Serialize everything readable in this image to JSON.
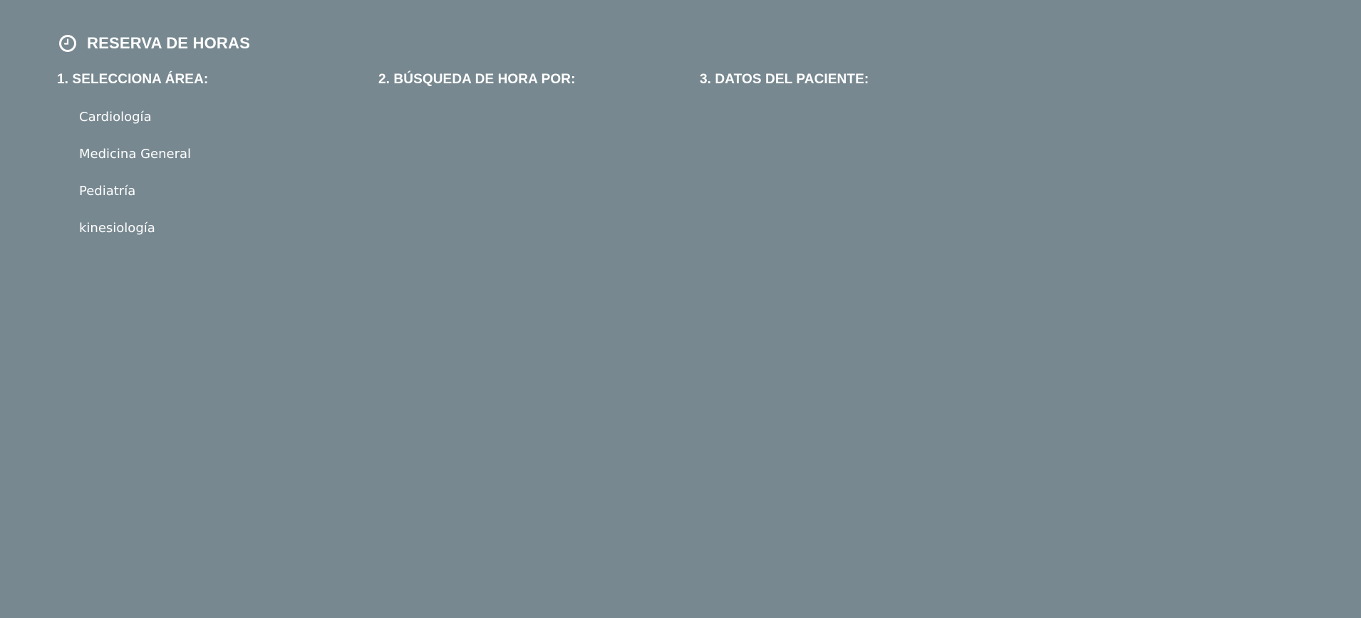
{
  "header": {
    "icon": "clock-icon",
    "title": "RESERVA DE HORAS"
  },
  "steps": [
    {
      "label": "1. SELECCIONA ÁREA:"
    },
    {
      "label": "2. BÚSQUEDA DE HORA POR:"
    },
    {
      "label": "3. DATOS DEL PACIENTE:"
    }
  ],
  "areas": [
    "Cardiología",
    "Medicina General",
    "Pediatría",
    "kinesiología"
  ],
  "colors": {
    "background": "#778890",
    "text": "#ffffff"
  }
}
